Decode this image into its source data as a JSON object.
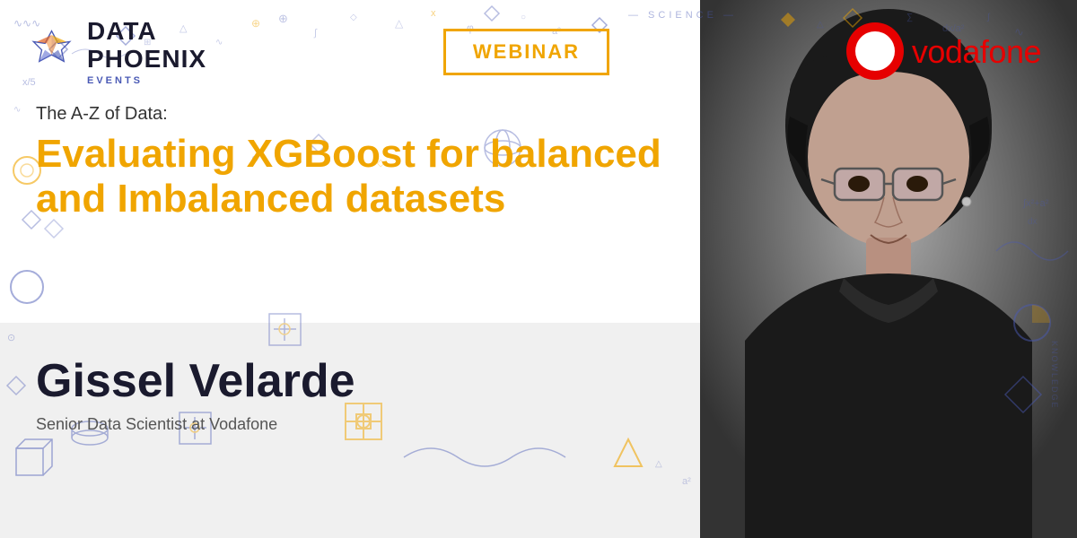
{
  "header": {
    "logo": {
      "data_text": "DATA",
      "phoenix_text": "PHOENIX",
      "events_text": "EVENTS"
    },
    "webinar_badge": "WEBINAR",
    "vodafone": {
      "name": "vodafone"
    }
  },
  "content": {
    "subtitle": "The A-Z of Data:",
    "main_title_line1": "Evaluating XGBoost for balanced",
    "main_title_line2": "and Imbalanced datasets"
  },
  "speaker": {
    "name": "Gissel Velarde",
    "title": "Senior Data Scientist at Vodafone"
  },
  "decorative": {
    "science_text": "SCIENCE",
    "knowledge_text": "KNOWLEDGE"
  }
}
